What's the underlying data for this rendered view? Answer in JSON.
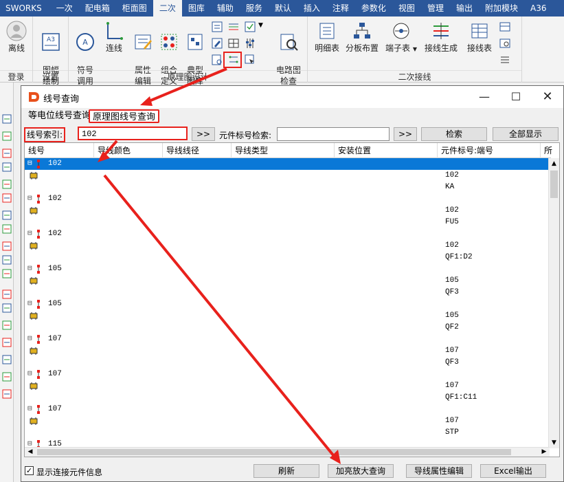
{
  "menubar": {
    "brand": "SWORKS",
    "items": [
      "一次",
      "配电箱",
      "柜面图",
      "二次",
      "图库",
      "辅助",
      "服务",
      "默认",
      "插入",
      "注释",
      "参数化",
      "视图",
      "管理",
      "输出",
      "附加模块",
      "A36"
    ],
    "active_index": 3
  },
  "ribbon": {
    "groups": [
      {
        "label": "登录",
        "buttons": [
          "离线"
        ]
      },
      {
        "label": "设置",
        "buttons": [
          "图幅\n绘制"
        ]
      },
      {
        "label": "原理图设计",
        "buttons": [
          "符号\n调用",
          "连线",
          "属性\n编辑",
          "组合\n定义",
          "典型\n图库",
          "电路图\n检查"
        ]
      },
      {
        "label": "二次接线",
        "buttons": [
          "明细表",
          "分板布置",
          "端子表",
          "接线生成",
          "接线表"
        ]
      }
    ]
  },
  "dialog": {
    "title": "线号查询",
    "tabs": [
      "等电位线号查询",
      "原理图线号查询"
    ],
    "active_tab": 1,
    "search": {
      "wire_label": "线号索引:",
      "wire_value": "102",
      "component_label": "元件标号检索:",
      "component_value": "",
      "more_btn": ">>",
      "search_btn": "检索",
      "showall_btn": "全部显示"
    },
    "columns": [
      "线号",
      "导线颜色",
      "导线线径",
      "导线类型",
      "安装位置",
      "元件标号:端号",
      "所"
    ],
    "rows": [
      {
        "kind": "wire",
        "text": "102",
        "selected": true
      },
      {
        "kind": "comp",
        "text": "102"
      },
      {
        "kind": "comp2",
        "text": "KA"
      },
      {
        "kind": "wire",
        "text": "102"
      },
      {
        "kind": "comp",
        "text": "102"
      },
      {
        "kind": "comp2",
        "text": "FU5"
      },
      {
        "kind": "wire",
        "text": "102"
      },
      {
        "kind": "comp",
        "text": "102"
      },
      {
        "kind": "comp2",
        "text": "QF1:D2"
      },
      {
        "kind": "wire",
        "text": "105"
      },
      {
        "kind": "comp",
        "text": "105"
      },
      {
        "kind": "comp2",
        "text": "QF3"
      },
      {
        "kind": "wire",
        "text": "105"
      },
      {
        "kind": "comp",
        "text": "105"
      },
      {
        "kind": "comp2",
        "text": "QF2"
      },
      {
        "kind": "wire",
        "text": "107"
      },
      {
        "kind": "comp",
        "text": "107"
      },
      {
        "kind": "comp2",
        "text": "QF3"
      },
      {
        "kind": "wire",
        "text": "107"
      },
      {
        "kind": "comp",
        "text": "107"
      },
      {
        "kind": "comp2",
        "text": "QF1:C11"
      },
      {
        "kind": "wire",
        "text": "107"
      },
      {
        "kind": "comp",
        "text": "107"
      },
      {
        "kind": "comp2",
        "text": "STP"
      },
      {
        "kind": "wire",
        "text": "115"
      }
    ],
    "footer": {
      "checkbox_label": "显示连接元件信息",
      "checkbox_checked": true,
      "refresh": "刷新",
      "highlight": "加亮放大查询",
      "wire_edit": "导线属性编辑",
      "excel": "Excel输出"
    }
  },
  "colors": {
    "menubar": "#2b579a",
    "selection": "#0a78d7",
    "annotation": "#e8211c"
  }
}
